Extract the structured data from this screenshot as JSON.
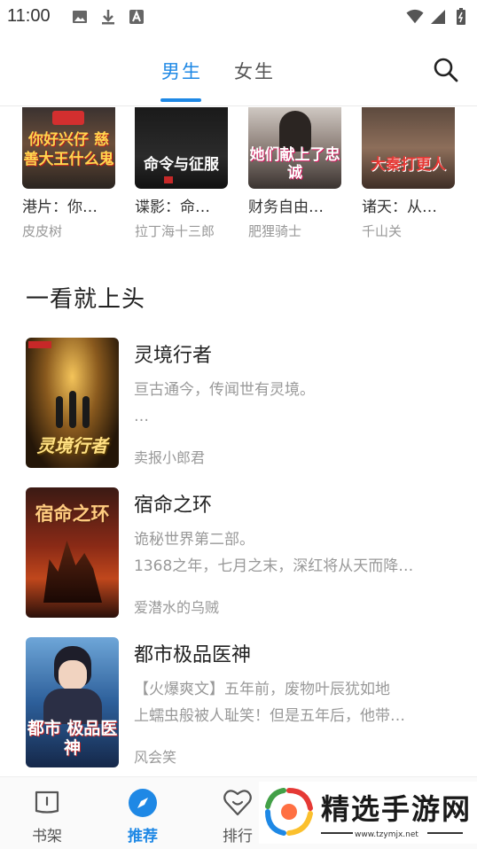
{
  "status_bar": {
    "time": "11:00",
    "left_icons": [
      "image-icon",
      "download-icon",
      "font-icon"
    ],
    "right_icons": [
      "wifi-icon",
      "signal-icon",
      "battery-icon"
    ]
  },
  "header": {
    "tabs": [
      {
        "label": "男生",
        "active": true
      },
      {
        "label": "女生",
        "active": false
      }
    ],
    "search_icon": "search-icon",
    "accent_color": "#1e88e5"
  },
  "top_books": [
    {
      "title": "港片：你…",
      "author": "皮皮树",
      "cover_text": "你好兴仔 慈善大王什么鬼"
    },
    {
      "title": "谍影：命…",
      "author": "拉丁海十三郎",
      "cover_text": "命令与征服"
    },
    {
      "title": "财务自由…",
      "author": "肥狸骑士",
      "cover_text": "她们献上了忠诚"
    },
    {
      "title": "诸天：从…",
      "author": "千山关",
      "cover_text": "大秦打更人"
    }
  ],
  "section": {
    "title": "一看就上头",
    "books": [
      {
        "title": "灵境行者",
        "desc_lines": [
          "亘古通今，传闻世有灵境。",
          "…"
        ],
        "author": "卖报小郎君",
        "cover_text": "灵境行者"
      },
      {
        "title": "宿命之环",
        "desc_lines": [
          "诡秘世界第二部。",
          "1368之年，七月之末，深红将从天而降…"
        ],
        "author": "爱潜水的乌贼",
        "cover_text": "宿命之环"
      },
      {
        "title": "都市极品医神",
        "desc_lines": [
          "【火爆爽文】五年前，废物叶辰犹如地",
          "上蠕虫般被人耻笑！但是五年后，他带…"
        ],
        "author": "风会笑",
        "cover_text": "都市 极品医神"
      }
    ]
  },
  "bottom_nav": {
    "items": [
      {
        "label": "书架",
        "icon": "bookshelf-icon",
        "active": false
      },
      {
        "label": "推荐",
        "icon": "compass-icon",
        "active": true
      },
      {
        "label": "排行",
        "icon": "ranking-icon",
        "active": false
      }
    ]
  },
  "watermark": {
    "text": "精选手游网",
    "url": "www.tzymjx.net"
  }
}
